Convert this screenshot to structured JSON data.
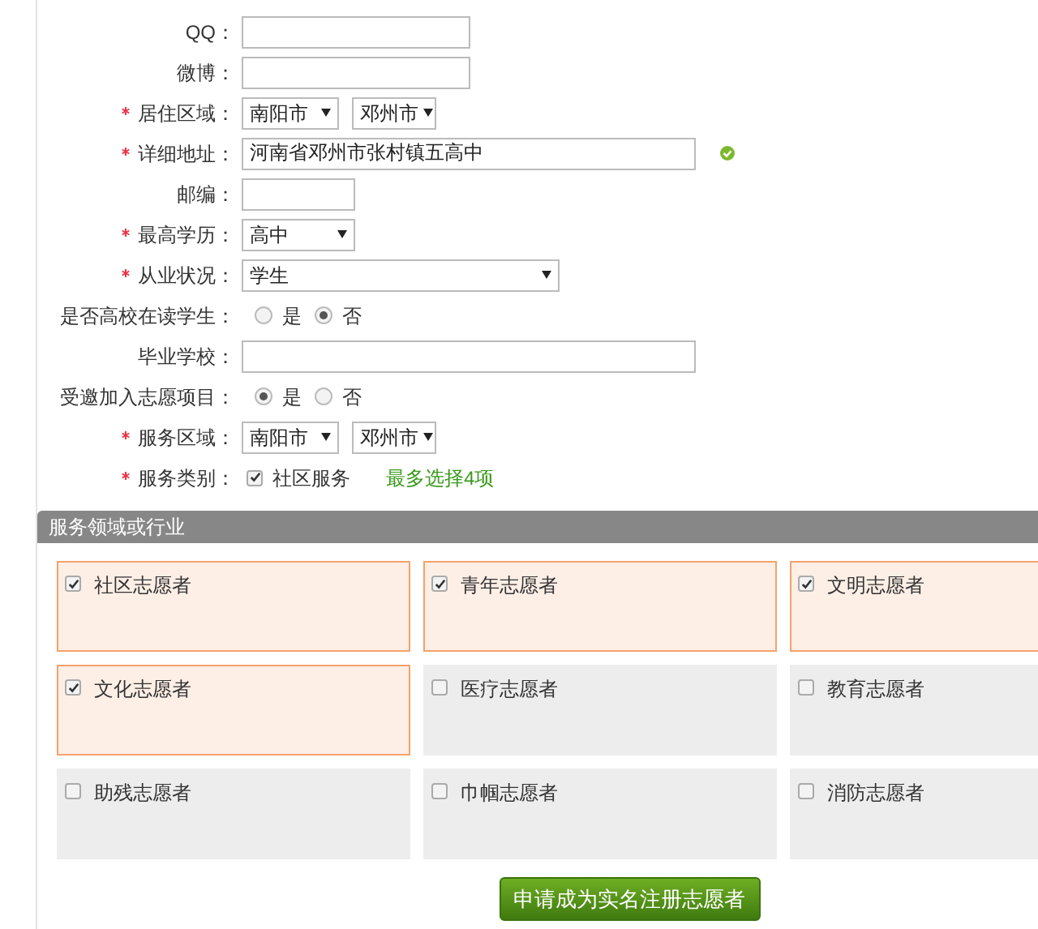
{
  "form_rows": [
    {
      "kind": "text",
      "required": false,
      "label": "QQ：",
      "value": ""
    },
    {
      "kind": "text",
      "required": false,
      "label": "微博：",
      "value": ""
    },
    {
      "kind": "select_pair",
      "required": true,
      "label": "居住区域：",
      "selects": [
        "南阳市",
        "邓州市"
      ]
    },
    {
      "kind": "text",
      "required": true,
      "label": "详细地址：",
      "value": "河南省邓州市张村镇五高中",
      "valid": true
    },
    {
      "kind": "text",
      "required": false,
      "label": "邮编：",
      "value": ""
    },
    {
      "kind": "select",
      "required": true,
      "label": "最高学历：",
      "value": "高中"
    },
    {
      "kind": "select",
      "required": true,
      "label": "从业状况：",
      "value": "学生"
    },
    {
      "kind": "radio",
      "required": false,
      "label": "是否高校在读学生：",
      "options": [
        {
          "label": "是",
          "selected": false
        },
        {
          "label": "否",
          "selected": true
        }
      ]
    },
    {
      "kind": "text",
      "required": false,
      "label": "毕业学校：",
      "value": ""
    },
    {
      "kind": "radio",
      "required": false,
      "label": "受邀加入志愿项目：",
      "options": [
        {
          "label": "是",
          "selected": true
        },
        {
          "label": "否",
          "selected": false
        }
      ]
    },
    {
      "kind": "select_pair",
      "required": true,
      "label": "服务区域：",
      "selects": [
        "南阳市",
        "邓州市"
      ]
    },
    {
      "kind": "checkbox",
      "required": true,
      "label": "服务类别：",
      "option": {
        "label": "社区服务",
        "checked": true
      },
      "hint": "最多选择4项"
    }
  ],
  "section": {
    "title": "服务领域或行业",
    "items": [
      {
        "label": "社区志愿者",
        "checked": true
      },
      {
        "label": "青年志愿者",
        "checked": true
      },
      {
        "label": "文明志愿者",
        "checked": true
      },
      {
        "label": "文化志愿者",
        "checked": true
      },
      {
        "label": "医疗志愿者",
        "checked": false
      },
      {
        "label": "教育志愿者",
        "checked": false
      },
      {
        "label": "助残志愿者",
        "checked": false
      },
      {
        "label": "巾帼志愿者",
        "checked": false
      },
      {
        "label": "消防志愿者",
        "checked": false
      }
    ]
  },
  "submit_button": "申请成为实名注册志愿者"
}
